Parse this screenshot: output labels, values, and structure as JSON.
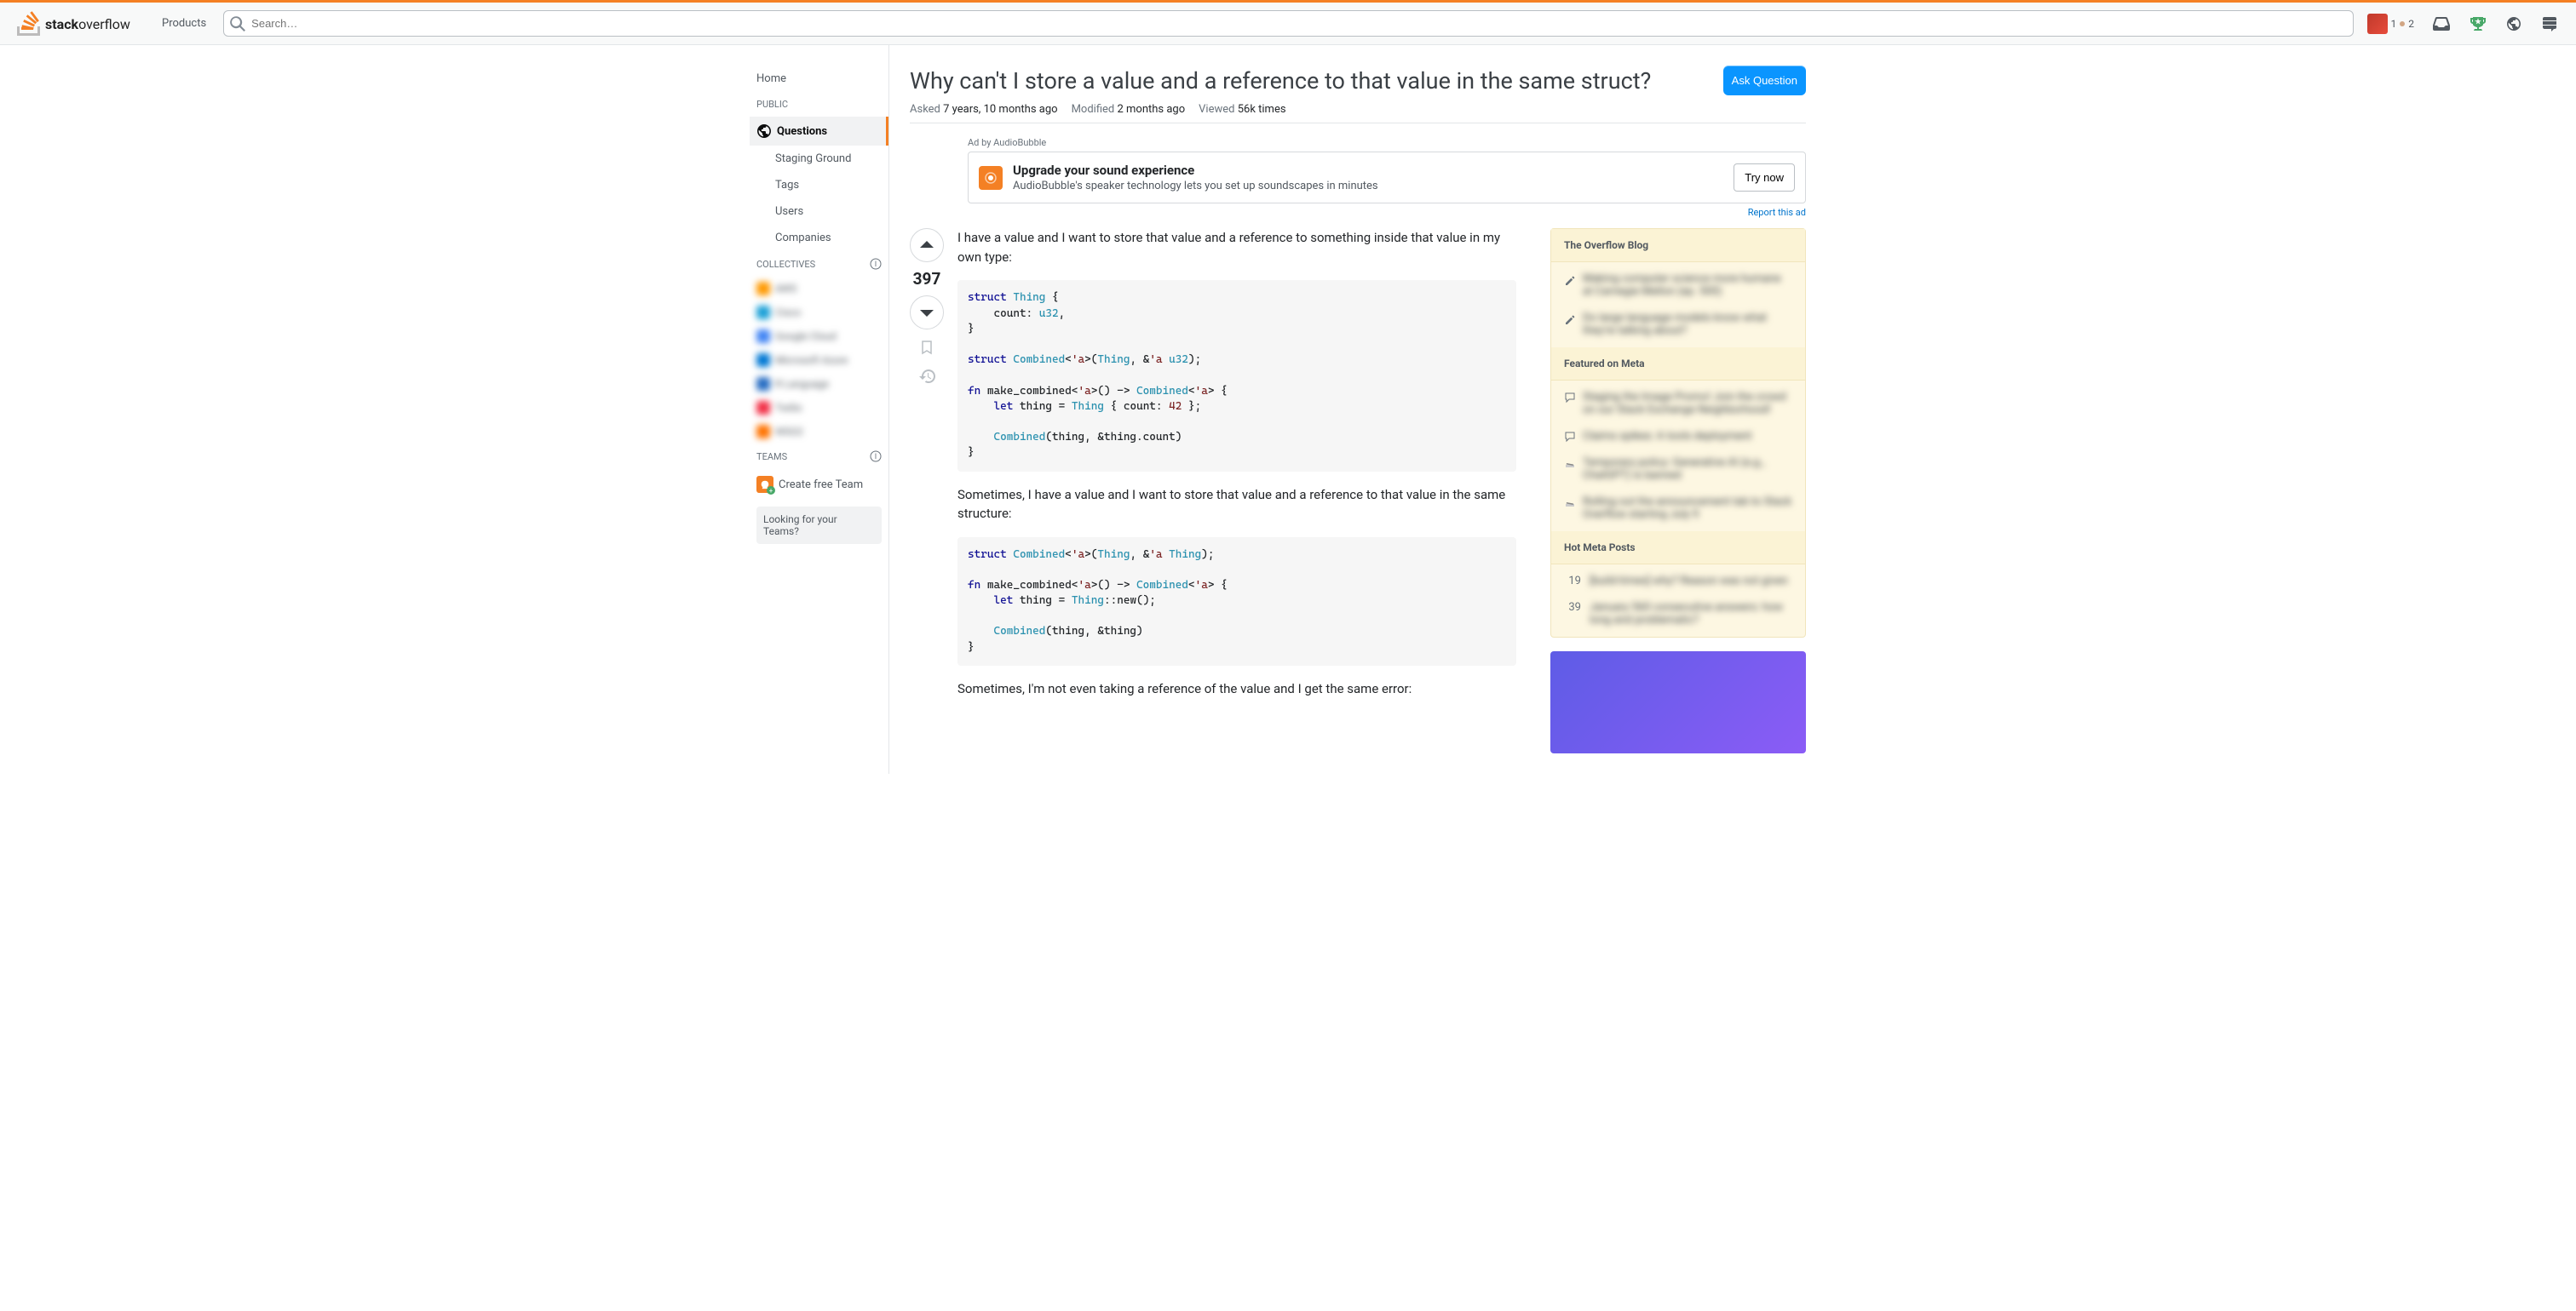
{
  "topbar": {
    "products_label": "Products",
    "search_placeholder": "Search…",
    "user_rep": "1",
    "user_bronze": "2"
  },
  "left_nav": {
    "home": "Home",
    "public_heading": "PUBLIC",
    "questions": "Questions",
    "staging": "Staging Ground",
    "tags": "Tags",
    "users": "Users",
    "companies": "Companies",
    "collectives_heading": "COLLECTIVES",
    "collectives": [
      "AWS",
      "Cisco",
      "Google Cloud",
      "Microsoft Azure",
      "R Language",
      "Twilio",
      "WSO2"
    ],
    "teams_heading": "TEAMS",
    "create_team": "Create free Team",
    "looking_for": "Looking for your Teams?"
  },
  "question": {
    "title": "Why can't I store a value and a reference to that value in the same struct?",
    "ask_button": "Ask Question",
    "asked_label": "Asked",
    "asked_value": "7 years, 10 months ago",
    "modified_label": "Modified",
    "modified_value": "2 months ago",
    "viewed_label": "Viewed",
    "viewed_value": "56k times",
    "vote_count": "397"
  },
  "ad": {
    "by_label": "Ad by AudioBubble",
    "title": "Upgrade your sound experience",
    "desc": "AudioBubble's speaker technology lets you set up soundscapes in minutes",
    "cta": "Try now",
    "report": "Report this ad"
  },
  "body": {
    "p1": "I have a value and I want to store that value and a reference to something inside that value in my own type:",
    "code1": "struct Thing {\n    count: u32,\n}\n\nstruct Combined<'a>(Thing, &'a u32);\n\nfn make_combined<'a>() -> Combined<'a> {\n    let thing = Thing { count: 42 };\n\n    Combined(thing, &thing.count)\n}",
    "p2": "Sometimes, I have a value and I want to store that value and a reference to that value in the same structure:",
    "code2": "struct Combined<'a>(Thing, &'a Thing);\n\nfn make_combined<'a>() -> Combined<'a> {\n    let thing = Thing::new();\n\n    Combined(thing, &thing)\n}",
    "p3": "Sometimes, I'm not even taking a reference of the value and I get the same error:"
  },
  "sidebar": {
    "blog_header": "The Overflow Blog",
    "blog_items": [
      "Making computer science more humane at Carnegie Mellon (ep. 500)",
      "Do large language models know what they're talking about?"
    ],
    "meta_header": "Featured on Meta",
    "meta_items": [
      "Staging the Image Promo! Join the crowd on our Stack Exchange Neighborhood!",
      "Claims spikes: A tools deployment",
      "Temporary policy: Generative AI (e.g., ChatGPT) is banned",
      "Rolling out the announcement tab to Stack Overflow starting July 9"
    ],
    "hot_header": "Hot Meta Posts",
    "hot_items": [
      {
        "score": "19",
        "text": "[build-times] why? Reason was not given"
      },
      {
        "score": "39",
        "text": "January 560 consecutive answers: how long and problematic?"
      }
    ]
  }
}
